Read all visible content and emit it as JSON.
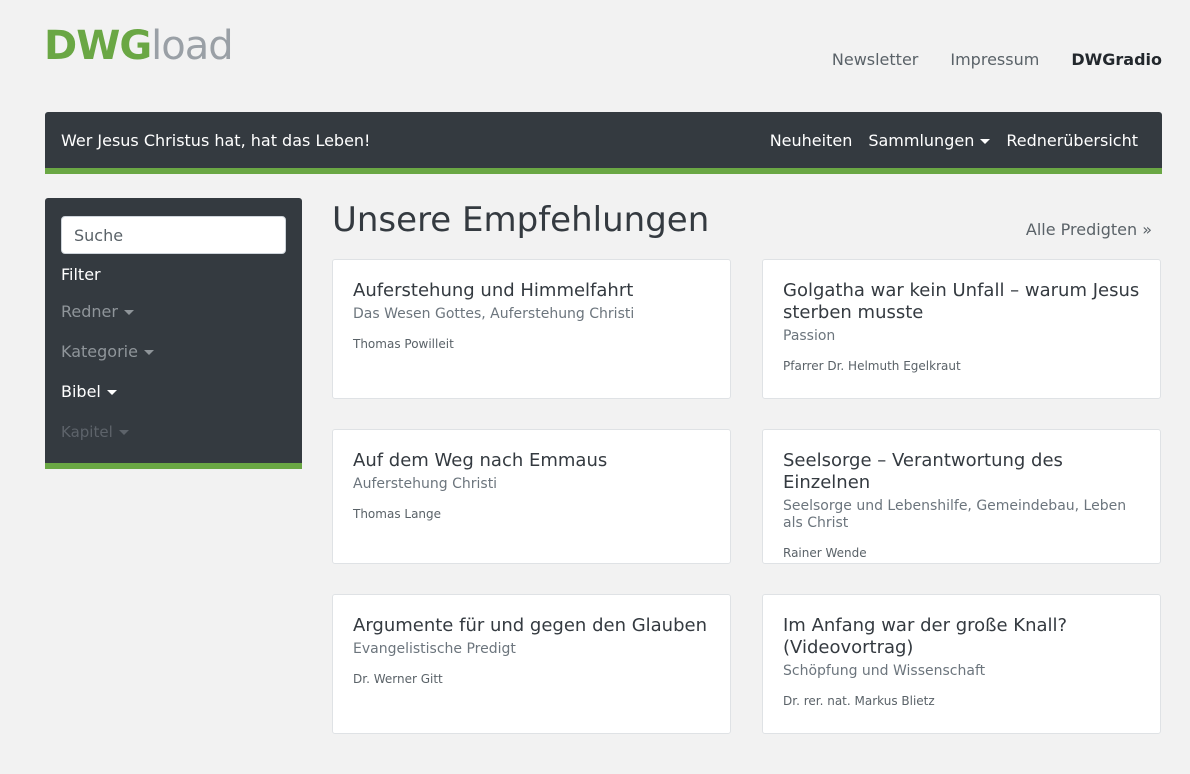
{
  "brand": {
    "part1": "DWG",
    "part2": "load"
  },
  "top_nav": [
    "Newsletter",
    "Impressum",
    "DWGradio"
  ],
  "navbar": {
    "slogan": "Wer Jesus Christus hat, hat das Leben!",
    "links": [
      "Neuheiten",
      "Sammlungen",
      "Rednerübersicht"
    ]
  },
  "sidebar": {
    "search_placeholder": "Suche",
    "filter_label": "Filter",
    "filters": [
      "Redner",
      "Kategorie",
      "Bibel",
      "Kapitel"
    ]
  },
  "main": {
    "heading": "Unsere Empfehlungen",
    "all_link": "Alle Predigten »",
    "cards": [
      {
        "title": "Auferstehung und Himmelfahrt",
        "topics": "Das Wesen Gottes, Auferstehung Christi",
        "speaker": "Thomas Powilleit"
      },
      {
        "title": "Golgatha war kein Unfall – warum Jesus sterben musste",
        "topics": "Passion",
        "speaker": "Pfarrer Dr. Helmuth Egelkraut"
      },
      {
        "title": "Auf dem Weg nach Emmaus",
        "topics": "Auferstehung Christi",
        "speaker": "Thomas Lange"
      },
      {
        "title": "Seelsorge – Verantwortung des Einzelnen",
        "topics": "Seelsorge und Lebenshilfe, Gemeindebau, Leben als Christ",
        "speaker": "Rainer Wende"
      },
      {
        "title": "Argumente für und gegen den Glauben",
        "topics": "Evangelistische Predigt",
        "speaker": "Dr. Werner Gitt"
      },
      {
        "title": "Im Anfang war der große Knall? (Videovortrag)",
        "topics": "Schöpfung und Wissenschaft",
        "speaker": "Dr. rer. nat. Markus Blietz"
      }
    ]
  },
  "colors": {
    "accent": "#6aa744",
    "dark": "#343a40",
    "background": "#f2f2f2"
  }
}
